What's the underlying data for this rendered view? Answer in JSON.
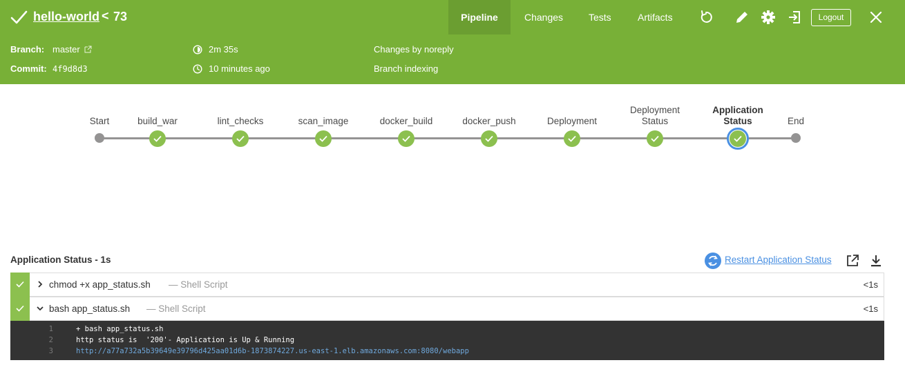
{
  "header": {
    "job_name": "hello-world",
    "separator": "<",
    "run_number": "73",
    "tabs": [
      {
        "label": "Pipeline",
        "active": true
      },
      {
        "label": "Changes",
        "active": false
      },
      {
        "label": "Tests",
        "active": false
      },
      {
        "label": "Artifacts",
        "active": false
      }
    ],
    "logout_label": "Logout",
    "icons": [
      "rerun-icon",
      "edit-icon",
      "gear-icon",
      "exit-classic-icon",
      "close-icon"
    ],
    "brand_color": "#78b037"
  },
  "info": {
    "branch_label": "Branch:",
    "branch_value": "master",
    "commit_label": "Commit:",
    "commit_value": "4f9d8d3",
    "duration": "2m 35s",
    "started": "10 minutes ago",
    "changes": "Changes by noreply",
    "cause": "Branch indexing"
  },
  "pipeline": {
    "stages": [
      {
        "label": "Start",
        "status": "none"
      },
      {
        "label": "build_war",
        "status": "success"
      },
      {
        "label": "lint_checks",
        "status": "success"
      },
      {
        "label": "scan_image",
        "status": "success"
      },
      {
        "label": "docker_build",
        "status": "success"
      },
      {
        "label": "docker_push",
        "status": "success"
      },
      {
        "label": "Deployment",
        "status": "success"
      },
      {
        "label_line1": "Deployment",
        "label_line2": "Status",
        "status": "success"
      },
      {
        "label_line1": "Application",
        "label_line2": "Status",
        "status": "success",
        "selected": true
      },
      {
        "label": "End",
        "status": "none"
      }
    ],
    "success_color": "#8cc04f",
    "selected_color": "#4a90e2"
  },
  "step_detail": {
    "title": "Application Status - 1s",
    "restart_label": "Restart Application Status",
    "steps": [
      {
        "command": "chmod +x app_status.sh",
        "description": "— Shell Script",
        "duration": "<1s",
        "expanded": false
      },
      {
        "command": "bash app_status.sh",
        "description": "— Shell Script",
        "duration": "<1s",
        "expanded": true
      }
    ],
    "console": [
      {
        "line": "1",
        "text": "+ bash app_status.sh"
      },
      {
        "line": "2",
        "text": "http status is  '200'- Application is Up & Running"
      },
      {
        "line": "3",
        "text": "http://a77a732a5b39649e39796d425aa01d6b-1873874227.us-east-1.elb.amazonaws.com:8080/webapp"
      }
    ]
  }
}
